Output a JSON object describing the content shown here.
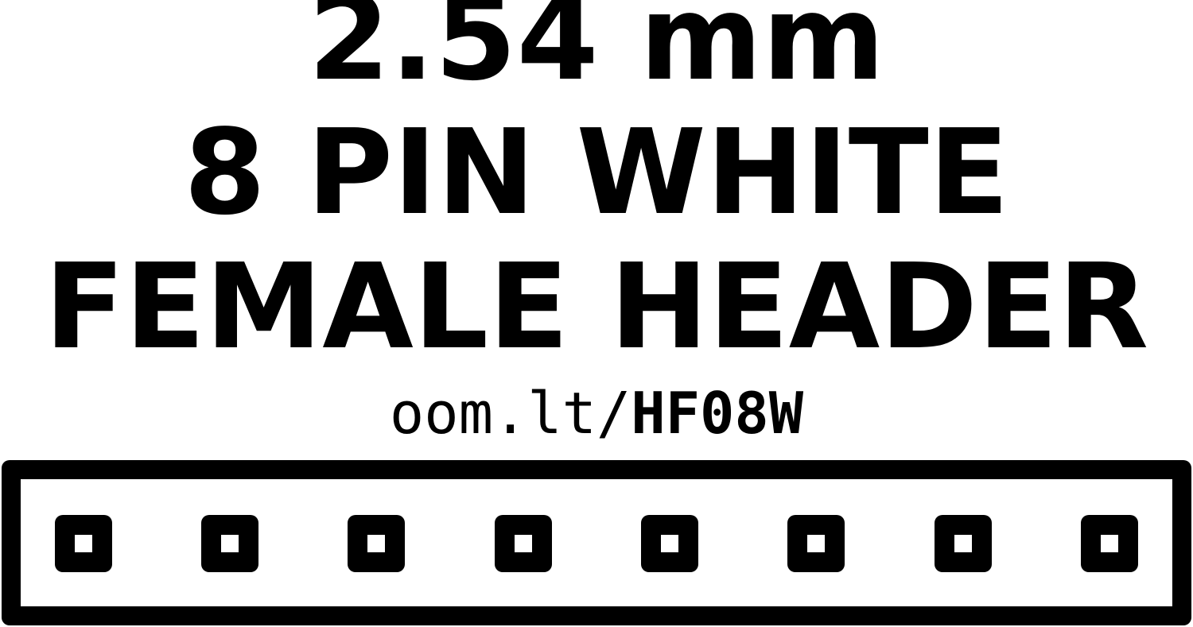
{
  "title": {
    "line1": "2.54 mm",
    "line2": "8 PIN WHITE",
    "line3": "FEMALE HEADER"
  },
  "link": {
    "prefix": "oom.lt/",
    "code": "HF08W"
  },
  "header": {
    "pin_count": 8
  },
  "colors": {
    "foreground": "#000000",
    "background": "#ffffff"
  }
}
